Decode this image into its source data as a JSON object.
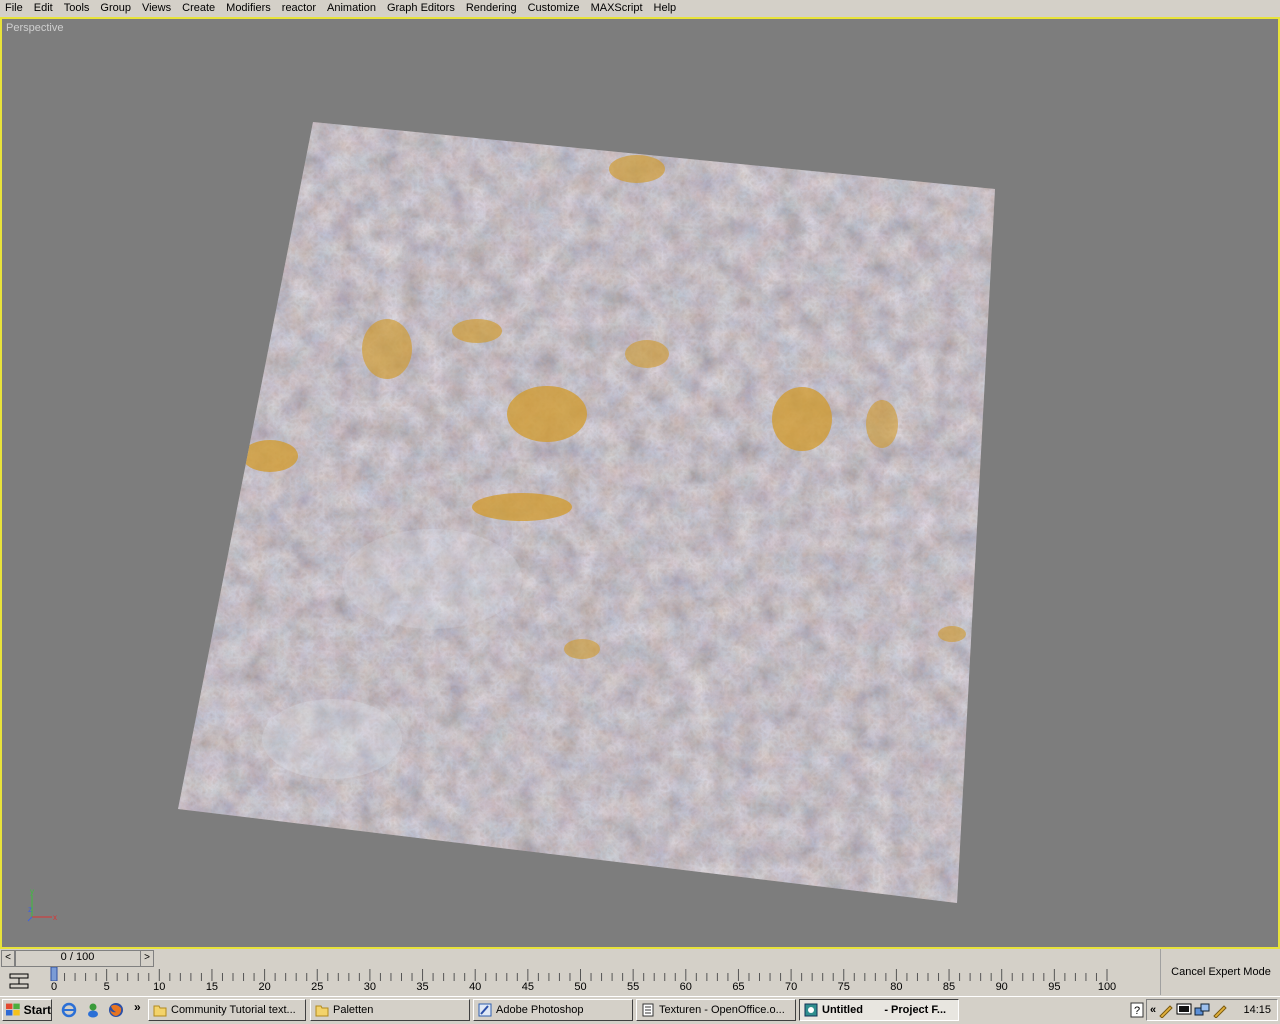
{
  "menu": [
    "File",
    "Edit",
    "Tools",
    "Group",
    "Views",
    "Create",
    "Modifiers",
    "reactor",
    "Animation",
    "Graph Editors",
    "Rendering",
    "Customize",
    "MAXScript",
    "Help"
  ],
  "viewport": {
    "label": "Perspective",
    "border_color": "#e8e33a",
    "background": "#7d7d7d"
  },
  "axis": {
    "x": "x",
    "y": "y",
    "z": "z"
  },
  "time_slider": {
    "position": "0 / 100",
    "left_arrow": "<",
    "right_arrow": ">"
  },
  "ruler_ticks": [
    "0",
    "5",
    "10",
    "15",
    "20",
    "25",
    "30",
    "35",
    "40",
    "45",
    "50",
    "55",
    "60",
    "65",
    "70",
    "75",
    "80",
    "85",
    "90",
    "95",
    "100"
  ],
  "expert_mode": "Cancel Expert Mode",
  "taskbar": {
    "start": "Start",
    "chevron": "»",
    "tasks": [
      {
        "label": "Community Tutorial text...",
        "icon": "folder-icon"
      },
      {
        "label": "Paletten",
        "icon": "folder-icon"
      },
      {
        "label": "Adobe Photoshop",
        "icon": "photoshop-icon"
      },
      {
        "label": "Texturen - OpenOffice.o...",
        "icon": "document-icon"
      },
      {
        "label": "Untitled       - Project F...",
        "icon": "3dsmax-icon"
      }
    ],
    "tray_chevron": "«",
    "clock": "14:15"
  }
}
